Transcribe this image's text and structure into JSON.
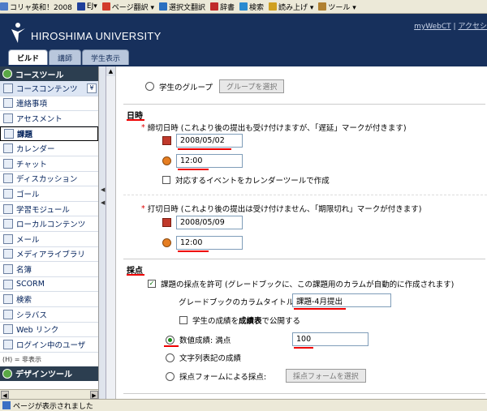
{
  "ie_toolbar": {
    "items": [
      {
        "label": "コリャ英和！2008",
        "icon": "app-icon"
      },
      {
        "label": "EJ▾",
        "icon": "ej-icon"
      },
      {
        "label": "ページ翻訳 ▾",
        "icon": "page-translate-icon"
      },
      {
        "label": "選択文翻訳",
        "icon": "select-translate-icon"
      },
      {
        "label": "辞書",
        "icon": "dictionary-icon"
      },
      {
        "label": "検索",
        "icon": "search-icon"
      },
      {
        "label": "読み上げ ▾",
        "icon": "speaker-icon"
      },
      {
        "label": "ツール ▾",
        "icon": "tool-icon"
      }
    ]
  },
  "header": {
    "university": "HIROSHIMA UNIVERSITY",
    "link_mywebct": "myWebCT",
    "link_sep": " | ",
    "link_access": "アクセシ"
  },
  "tabs": [
    {
      "label": "ビルド",
      "active": true
    },
    {
      "label": "講師",
      "active": false
    },
    {
      "label": "学生表示",
      "active": false
    }
  ],
  "sidebar": {
    "course_tools_title": "コースツール",
    "items": [
      {
        "label": "コースコンテンツ",
        "icon": "home-icon",
        "state": "sel",
        "dropdown": "¥"
      },
      {
        "label": "連絡事項",
        "icon": "announcement-icon"
      },
      {
        "label": "アセスメント",
        "icon": "assessment-icon"
      },
      {
        "label": "課題",
        "icon": "assignment-icon",
        "state": "active"
      },
      {
        "label": "カレンダー",
        "icon": "calendar-icon"
      },
      {
        "label": "チャット",
        "icon": "chat-icon"
      },
      {
        "label": "ディスカッション",
        "icon": "discussion-icon"
      },
      {
        "label": "ゴール",
        "icon": "goal-icon"
      },
      {
        "label": "学習モジュール",
        "icon": "module-icon"
      },
      {
        "label": "ローカルコンテンツ",
        "icon": "local-content-icon"
      },
      {
        "label": "メール",
        "icon": "mail-icon"
      },
      {
        "label": "メディアライブラリ",
        "icon": "media-library-icon"
      },
      {
        "label": "名簿",
        "icon": "roster-icon"
      },
      {
        "label": "SCORM",
        "icon": "scorm-icon"
      },
      {
        "label": "検索",
        "icon": "search-icon"
      },
      {
        "label": "シラバス",
        "icon": "syllabus-icon"
      },
      {
        "label": "Web リンク",
        "icon": "weblink-icon"
      },
      {
        "label": "ログイン中のユーザ",
        "icon": "users-online-icon"
      }
    ],
    "legend": "(H) = 非表示",
    "design_tools_title": "デザインツール"
  },
  "main": {
    "student_group_label": "学生のグループ",
    "select_group_button": "グループを選択",
    "datetime_section": "日時",
    "due_label": "締切日時 (これより後の提出も受け付けますが、「遅延」マークが付きます)",
    "due_date": "2008/05/02",
    "due_time": "12:00",
    "calendar_event_label": "対応するイベントをカレンダーツールで作成",
    "cutoff_label": "打切日時 (これより後の提出は受け付けません、「期限切れ」マークが付きます)",
    "cutoff_date": "2008/05/09",
    "cutoff_time": "12:00",
    "grading_section": "採点",
    "allow_grading_label": "課題の採点を許可 (グレードブックに、この課題用のカラムが自動的に作成されます)",
    "column_title_label": "グレードブックのカラムタイトル:",
    "column_title_value": "課題-4月提出",
    "publish_grade_pre": "学生の成績を",
    "publish_grade_bold": "成績表",
    "publish_grade_post": "で公開する",
    "numeric_grade_label": "数値成績: 満点",
    "numeric_grade_value": "100",
    "text_grade_label": "文字列表記の成績",
    "form_grade_label": "採点フォームによる採点:",
    "select_form_button": "採点フォームを選択"
  },
  "status": {
    "text": "ページが表示されました"
  },
  "colors": {
    "header_bg": "#17305c",
    "accent_red": "#e00000",
    "link": "#00205a"
  }
}
